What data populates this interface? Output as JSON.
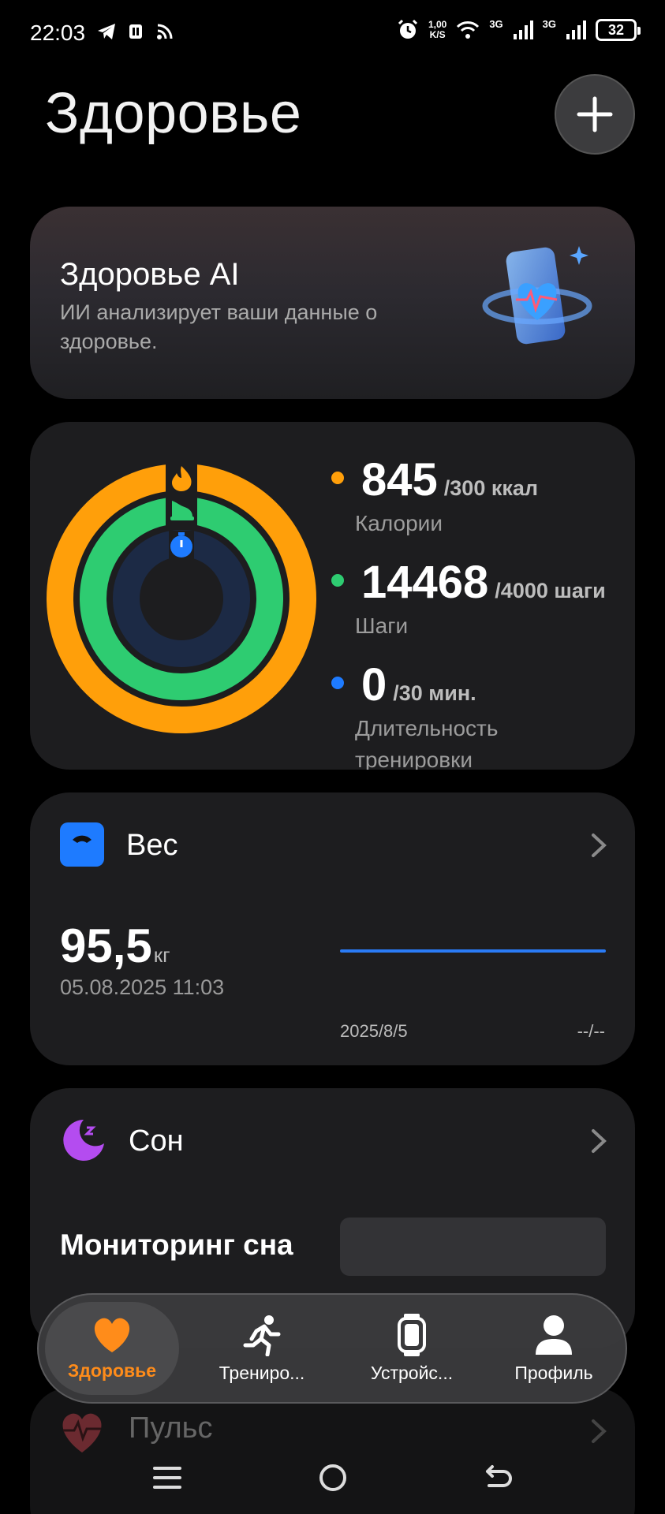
{
  "status_bar": {
    "time": "22:03",
    "speed_value": "1,00",
    "speed_unit": "K/S",
    "network1": "3G",
    "network2": "3G",
    "battery": "32"
  },
  "header": {
    "title": "Здоровье",
    "add_icon": "plus-icon"
  },
  "ai_card": {
    "title": "Здоровье AI",
    "subtitle": "ИИ анализирует ваши данные о здоровье."
  },
  "activity": {
    "metrics": [
      {
        "value": "845",
        "goal": "/300 ккал",
        "label": "Калории",
        "color": "#ff9f0a"
      },
      {
        "value": "14468",
        "goal": "/4000 шаги",
        "label": "Шаги",
        "color": "#2ecc71"
      },
      {
        "value": "0",
        "goal": "/30 мин.",
        "label": "Длительность тренировки",
        "color": "#1e7bff"
      }
    ],
    "rings": {
      "calories_progress": 1.0,
      "steps_progress": 1.0,
      "duration_progress": 0.0
    }
  },
  "weight": {
    "title": "Вес",
    "value": "95,5",
    "unit": "кг",
    "date": "05.08.2025 11:03",
    "chart_start": "2025/8/5",
    "chart_end": "--/--"
  },
  "sleep": {
    "title": "Сон",
    "monitor_label": "Мониторинг сна"
  },
  "pulse": {
    "title": "Пульс"
  },
  "bottom_nav": {
    "items": [
      {
        "label": "Здоровье",
        "icon": "heart-icon",
        "active": true
      },
      {
        "label": "Трениро...",
        "icon": "running-icon",
        "active": false
      },
      {
        "label": "Устройс...",
        "icon": "watch-icon",
        "active": false
      },
      {
        "label": "Профиль",
        "icon": "profile-icon",
        "active": false
      }
    ]
  },
  "colors": {
    "orange": "#ff9f0a",
    "green": "#2ecc71",
    "blue": "#1e7bff",
    "purple": "#b44cf0",
    "card_bg": "#1d1d1f"
  }
}
